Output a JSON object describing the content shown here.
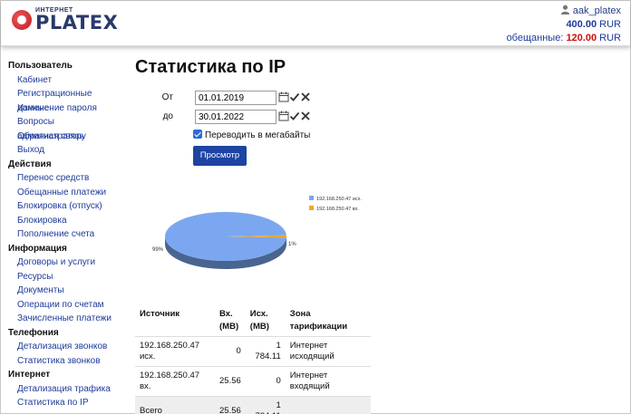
{
  "logo": {
    "small": "ИНТЕРНЕТ",
    "name": "PLATEX"
  },
  "account": {
    "username": "aak_platex",
    "balance": "400.00",
    "currency": "RUR",
    "promise_label": "обещанные:",
    "promise": "120.00",
    "promise_currency": "RUR"
  },
  "sidebar": [
    {
      "title": "Пользователь",
      "items": [
        "Кабинет",
        "Регистрационные данные",
        "Изменение пароля",
        "Вопросы администратору",
        "Обратная связь",
        "Выход"
      ]
    },
    {
      "title": "Действия",
      "items": [
        "Перенос средств",
        "Обещанные платежи",
        "Блокировка (отпуск)",
        "Блокировка",
        "Пополнение счета"
      ]
    },
    {
      "title": "Информация",
      "items": [
        "Договоры и услуги",
        "Ресурсы",
        "Документы",
        "Операции по счетам",
        "Зачисленные платежи"
      ]
    },
    {
      "title": "Телефония",
      "items": [
        "Детализация звонков",
        "Статистика звонков"
      ]
    },
    {
      "title": "Интернет",
      "items": [
        "Детализация трафика",
        "Статистика по IP"
      ]
    }
  ],
  "page": {
    "title": "Статистика по IP"
  },
  "form": {
    "from_label": "От",
    "from_value": "01.01.2019",
    "to_label": "до",
    "to_value": "30.01.2022",
    "convert_label": "Переводить в мегабайты",
    "submit_label": "Просмотр"
  },
  "colors": {
    "inbound": "#7ba7f0",
    "outbound": "#f5a623",
    "accent": "#1d44a3"
  },
  "chart_data": {
    "type": "pie",
    "slices": [
      {
        "label": "192.168.250.47 исх.",
        "value": 1784.11,
        "percent_label": "99%",
        "color": "#7ba7f0"
      },
      {
        "label": "192.168.250.47 вх.",
        "value": 25.56,
        "percent_label": "1%",
        "color": "#f5a623"
      }
    ],
    "legend": [
      "192.168.250.47 исх.",
      "192.168.250.47 вх."
    ],
    "legend_position": "top-right"
  },
  "table": {
    "headers": [
      "Источник",
      "Вх. (MB)",
      "Исх. (MB)",
      "Зона тарификации"
    ],
    "rows": [
      [
        "192.168.250.47 исх.",
        "0",
        "1 784.11",
        "Интернет исходящий"
      ],
      [
        "192.168.250.47 вх.",
        "25.56",
        "0",
        "Интернет входящий"
      ]
    ],
    "total": [
      "Всего",
      "25.56",
      "1 784.11",
      ""
    ]
  }
}
